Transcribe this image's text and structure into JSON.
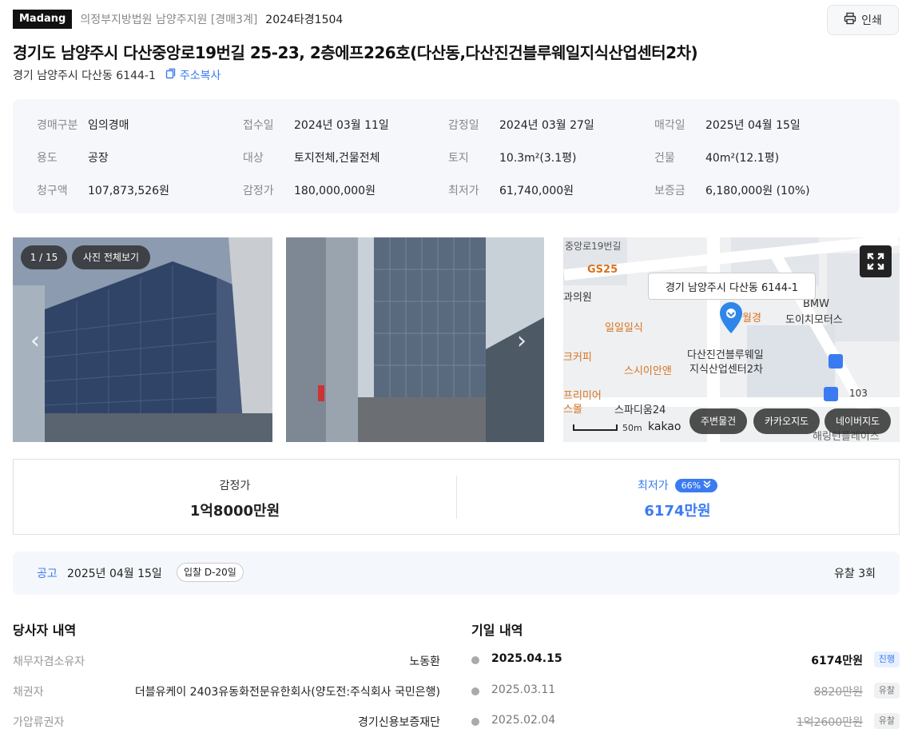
{
  "header": {
    "logo": "Madang",
    "court": "의정부지방법원 남양주지원 [경매3계]",
    "case_no": "2024타경1504",
    "print_label": "인쇄",
    "title": "경기도 남양주시 다산중앙로19번길 25-23, 2층에프226호(다산동,다산진건블루웨일지식산업센터2차)",
    "sub_address": "경기 남양주시 다산동 6144-1",
    "copy_label": "주소복사"
  },
  "info": {
    "rows": [
      [
        {
          "k": "경매구분",
          "v": "임의경매"
        },
        {
          "k": "접수일",
          "v": "2024년 03월 11일"
        },
        {
          "k": "감정일",
          "v": "2024년 03월 27일"
        },
        {
          "k": "매각일",
          "v": "2025년 04월 15일"
        }
      ],
      [
        {
          "k": "용도",
          "v": "공장"
        },
        {
          "k": "대상",
          "v": "토지전체,건물전체"
        },
        {
          "k": "토지",
          "v": "10.3m²(3.1평)"
        },
        {
          "k": "건물",
          "v": "40m²(12.1평)"
        }
      ],
      [
        {
          "k": "청구액",
          "v": "107,873,526원"
        },
        {
          "k": "감정가",
          "v": "180,000,000원"
        },
        {
          "k": "최저가",
          "v": "61,740,000원"
        },
        {
          "k": "보증금",
          "v": "6,180,000원 (10%)"
        }
      ]
    ]
  },
  "gallery": {
    "counter": "1 / 15",
    "view_all": "사진 전체보기"
  },
  "map": {
    "tooltip": "경기 남양주시 다산동 6144-1",
    "labels": {
      "road": "중앙로19번길",
      "gs25": "GS25",
      "clinic": "과의원",
      "ilil": "일일일식",
      "coffee": "크커피",
      "susian": "스시이안앤",
      "premier": "프리미어",
      "mall": "스몰",
      "spadium": "스파디움24",
      "building": "다산진건블루웨일",
      "building2": "지식산업센터2차",
      "bmw": "BMW",
      "bmw2": "도이치모터스",
      "bus": "103",
      "bottom": "해링턴플레이스",
      "wolgyeong": "월경",
      "scale": "50m",
      "brand": "kakao"
    },
    "btn_nearby": "주변물건",
    "btn_kakao": "카카오지도",
    "btn_naver": "네이버지도"
  },
  "price": {
    "appraisal_label": "감정가",
    "appraisal_value": "1억8000만원",
    "minimum_label": "최저가",
    "minimum_pct": "66%",
    "minimum_value": "6174만원"
  },
  "notice": {
    "label": "공고",
    "date": "2025년 04월 15일",
    "dday": "입찰 D-20일",
    "fail_count": "유찰 3회"
  },
  "parties": {
    "title": "당사자 내역",
    "rows": [
      {
        "k": "채무자겸소유자",
        "v": "노동환"
      },
      {
        "k": "채권자",
        "v": "더블유케이 2403유동화전문유한회사(양도전:주식회사 국민은행)"
      },
      {
        "k": "가압류권자",
        "v": "경기신용보증재단"
      }
    ]
  },
  "dates": {
    "title": "기일 내역",
    "rows": [
      {
        "date": "2025.04.15",
        "price": "6174만원",
        "status": "진행"
      },
      {
        "date": "2025.03.11",
        "price": "8820만원",
        "status": "유찰"
      },
      {
        "date": "2025.02.04",
        "price": "1억2600만원",
        "status": "유찰"
      }
    ]
  },
  "colors": {
    "accent": "#3a7bf2",
    "map_orange": "#d9731f",
    "marker": "#2f86e8"
  }
}
